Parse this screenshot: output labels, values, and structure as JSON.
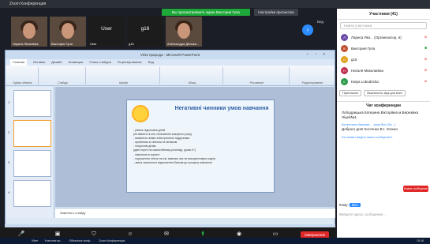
{
  "zoom": {
    "title": "Zoom Конференция",
    "share_banner": "Вы просматриваете экран Виктория Гула",
    "view_options": "Настройки просмотра",
    "view_label": "Вид"
  },
  "videos": [
    {
      "name": "Лариса Яковлева",
      "kind": "cam"
    },
    {
      "name": "Виктория Гула",
      "kind": "cam"
    },
    {
      "name": "User",
      "big": "User",
      "kind": "text"
    },
    {
      "name": "g16",
      "big": "g16",
      "kind": "text"
    },
    {
      "name": "Александра Деника...",
      "kind": "cam"
    }
  ],
  "ppt": {
    "title": "VIN2 природа - Microsoft PowerPoint",
    "tabs": [
      "Главная",
      "Вставка",
      "Дизайн",
      "Анимация",
      "Показ слайдов",
      "Рецензирование",
      "Вид"
    ],
    "groups": [
      "Буфер обмена",
      "Слайды",
      "Шрифт",
      "Абзац",
      "Рисование",
      "Редактирование"
    ],
    "slide_title": "Негативні чинники умов навчання",
    "bullets": [
      "- рівень підготовки дітей",
      "(не вміють ні м'я; неоновлені минулого року)",
      "- наявність аніме-електронного підручника",
      "- проблеми зі світлом та зв'язком",
      "- спорочню дітям",
      "(дані ноути на самостійному розгляді, уроки 4*)",
      "- навчання в скрипті",
      "- порушення гігієни на екі, вмикаю час не використовую сидіти",
      "- зміна загального відношення батьків до процесу навчання"
    ],
    "notes_placeholder": "Заметки к слайду",
    "slide_numbers": [
      "1",
      "2",
      "3",
      "4"
    ]
  },
  "toolbar": [
    {
      "icon": "🎤",
      "label": "Включить звук"
    },
    {
      "icon": "📹",
      "label": "Начать видео"
    },
    {
      "icon": "🛡",
      "label": "Безопасность"
    },
    {
      "icon": "👥",
      "label": "Участники"
    },
    {
      "icon": "💬",
      "label": "Чат"
    },
    {
      "icon": "⬆",
      "label": "Демонстрация экрана",
      "green": true
    },
    {
      "icon": "⏺",
      "label": "Приложения"
    },
    {
      "icon": "⏸",
      "label": "Доска сообщений"
    },
    {
      "icon": "⋯",
      "label": "Дополнительно"
    }
  ],
  "end_label": "Завершение",
  "participants": {
    "header": "Участники (41)",
    "search": "Найти участника",
    "list": [
      {
        "name": "Лариса Яко... (Организатор, я)",
        "color": "#6b4aa8",
        "initial": "Л"
      },
      {
        "name": "Виктория Гула",
        "color": "#c05030",
        "initial": "В"
      },
      {
        "name": "g16",
        "color": "#e0a020",
        "initial": "G"
      },
      {
        "name": "Наталя Миколаївна",
        "color": "#c03050",
        "initial": "Н"
      },
      {
        "name": "Katya Lobodricka",
        "color": "#2a9a4a",
        "initial": "K"
      }
    ],
    "invite": "Пригласить",
    "mute_all": "Выключить звук для всех"
  },
  "chat": {
    "header": "Чат конференции",
    "messages": [
      {
        "from": "",
        "text": "Лободрицька Катерина Вікторівна м.Березівка Ліцей№1"
      },
      {
        "from": "Валентина Иванова ... кому Все (Ли...)",
        "text": "Доброго дня! Костенко В.І. Усенко"
      }
    ],
    "new_message": "Новое сообщение",
    "who_can_see": "Кто может видеть ваши сообщения?",
    "to_label": "Кому:",
    "to_value": "Все",
    "input_placeholder": "Введите здесь сообщение..."
  },
  "taskbar": {
    "items": [
      "Viber",
      "Участник пр...",
      "Облачные конф...",
      "Zoom Конференции"
    ],
    "time": "15:16"
  }
}
